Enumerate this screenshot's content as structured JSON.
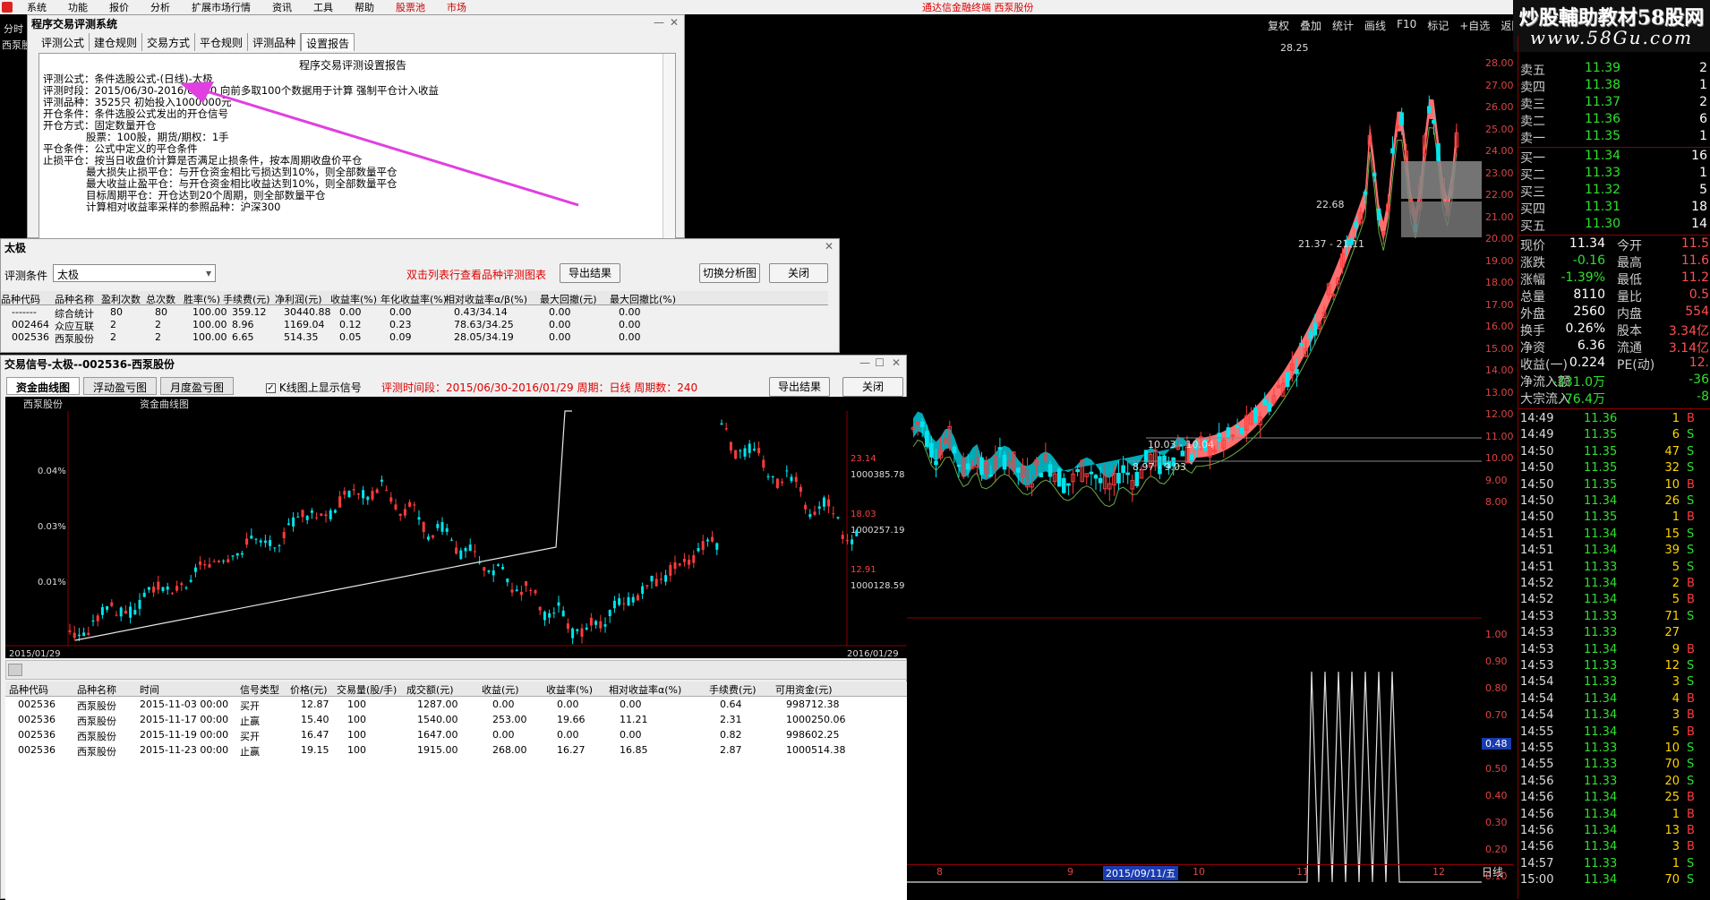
{
  "topbar": {
    "items": [
      "系统",
      "功能",
      "报价",
      "分析",
      "扩展市场行情",
      "资讯",
      "工具",
      "帮助"
    ],
    "red_items": [
      "股票池",
      "市场"
    ],
    "center_title": "通达信金融终端 西泵股份"
  },
  "left_strip": {
    "tab": "分时",
    "stock": "西泵股"
  },
  "toolbar": [
    "复权",
    "叠加",
    "统计",
    "画线",
    "F10",
    "标记",
    "+自选",
    "返回"
  ],
  "watermark": {
    "line1": "炒股輔助教材58股网",
    "line2": "www.58Gu.com"
  },
  "eval_window": {
    "title": "程序交易评测系统",
    "tabs": [
      "评测公式",
      "建仓规则",
      "交易方式",
      "平仓规则",
      "评测品种",
      "设置报告"
    ],
    "active_tab": 5,
    "report_heading": "程序交易评测设置报告",
    "report_lines": [
      {
        "indent": 0,
        "text": "评测公式：条件选股公式-(日线)-太极"
      },
      {
        "indent": 0,
        "text": "评测时段：2015/06/30-2016/01/30 向前多取100个数据用于计算 强制平仓计入收益"
      },
      {
        "indent": 0,
        "text": "评测品种：3525只 初始投入1000000元"
      },
      {
        "indent": 0,
        "text": "开仓条件：条件选股公式发出的开仓信号"
      },
      {
        "indent": 0,
        "text": "开仓方式：固定数量开仓"
      },
      {
        "indent": 1,
        "text": "股票：100股，期货/期权：1手"
      },
      {
        "indent": 0,
        "text": "平仓条件：公式中定义的平仓条件"
      },
      {
        "indent": 0,
        "text": "止损平仓：按当日收盘价计算是否满足止损条件，按本周期收盘价平仓"
      },
      {
        "indent": 1,
        "text": "最大损失止损平仓：与开仓资金相比亏损达到10%，则全部数量平仓"
      },
      {
        "indent": 1,
        "text": "最大收益止盈平仓：与开仓资金相比收益达到10%，则全部数量平仓"
      },
      {
        "indent": 1,
        "text": "目标周期平仓：开仓达到20个周期，则全部数量平仓"
      },
      {
        "indent": 1,
        "text": "计算相对收益率采样的参照品种：沪深300"
      }
    ]
  },
  "result_window": {
    "title": "太极",
    "condition_label": "评测条件",
    "condition_value": "太极",
    "hint": "双击列表行查看品种评测图表",
    "export_label": "导出结果",
    "switch_label": "切换分析图",
    "close_label": "关闭",
    "columns": [
      "品种代码",
      "品种名称",
      "盈利次数",
      "总次数",
      "胜率(%)",
      "手续费(元)",
      "净利润(元)",
      "收益率(%)",
      "年化收益率(%)",
      "相对收益率α/β(%)",
      "最大回撤(元)",
      "最大回撤比(%)"
    ],
    "rows": [
      [
        "-------",
        "综合统计",
        "80",
        "80",
        "100.00",
        "359.12",
        "30440.88",
        "0.00",
        "0.00",
        "0.43/34.14",
        "0.00",
        "0.00"
      ],
      [
        "002464",
        "众应互联",
        "2",
        "2",
        "100.00",
        "8.96",
        "1169.04",
        "0.12",
        "0.23",
        "78.63/34.25",
        "0.00",
        "0.00"
      ],
      [
        "002536",
        "西泵股份",
        "2",
        "2",
        "100.00",
        "6.65",
        "514.35",
        "0.05",
        "0.09",
        "28.05/34.19",
        "0.00",
        "0.00"
      ]
    ]
  },
  "signal_window": {
    "title": "交易信号-太极--002536-西泵股份",
    "tabs": [
      "资金曲线图",
      "浮动盈亏图",
      "月度盈亏图"
    ],
    "active_tab": 0,
    "checkbox_label": "K线图上显示信号",
    "info": "评测时间段：2015/06/30-2016/01/29  周期：日线  周期数：240",
    "export_label": "导出结果",
    "close_label": "关闭",
    "chart": {
      "stock_label": "西泵股份",
      "curve_label": "资金曲线图",
      "left_ticks": [
        "0.04%",
        "0.03%",
        "0.01%"
      ],
      "right_price_ticks": [
        "23.14",
        "18.03",
        "12.91"
      ],
      "right_fund_ticks": [
        "1000385.78",
        "1000257.19",
        "1000128.59"
      ],
      "start_date": "2015/01/29",
      "end_date": "2016/01/29"
    },
    "columns": [
      "品种代码",
      "品种名称",
      "时间",
      "信号类型",
      "价格(元)",
      "交易量(股/手)",
      "成交额(元)",
      "收益(元)",
      "收益率(%)",
      "相对收益率α(%)",
      "手续费(元)",
      "可用资金(元)"
    ],
    "rows": [
      [
        "002536",
        "西泵股份",
        "2015-11-03 00:00",
        "买开",
        "12.87",
        "100",
        "1287.00",
        "0.00",
        "0.00",
        "0.00",
        "0.64",
        "998712.38"
      ],
      [
        "002536",
        "西泵股份",
        "2015-11-17 00:00",
        "止赢",
        "15.40",
        "100",
        "1540.00",
        "253.00",
        "19.66",
        "11.21",
        "2.31",
        "1000250.06"
      ],
      [
        "002536",
        "西泵股份",
        "2015-11-19 00:00",
        "买开",
        "16.47",
        "100",
        "1647.00",
        "0.00",
        "0.00",
        "0.00",
        "0.82",
        "998602.25"
      ],
      [
        "002536",
        "西泵股份",
        "2015-11-23 00:00",
        "止赢",
        "19.15",
        "100",
        "1915.00",
        "268.00",
        "16.27",
        "16.85",
        "2.87",
        "1000514.38"
      ]
    ]
  },
  "main_chart": {
    "price_ticks": [
      "28.00",
      "27.00",
      "26.00",
      "25.00",
      "24.00",
      "23.00",
      "22.00",
      "21.00",
      "20.00",
      "19.00",
      "18.00",
      "17.00",
      "16.00",
      "15.00",
      "14.00",
      "13.00",
      "12.00",
      "11.00",
      "10.00",
      "9.00",
      "8.00"
    ],
    "indicator_ticks": [
      "1.00",
      "0.90",
      "0.80",
      "0.70",
      "0.60",
      "0.50",
      "0.40",
      "0.30",
      "0.20",
      "0.10"
    ],
    "indicator_value": "0.48",
    "annotations": [
      "28.25",
      "22.68",
      "21.37 - 21.11",
      "10.03 - 10.04",
      "8.97 - 9.03"
    ],
    "x_labels": [
      "8",
      "9",
      "2015/09/11/五",
      "10",
      "11",
      "12"
    ],
    "period": "日线"
  },
  "quote": {
    "sell": [
      [
        "卖五",
        "11.39",
        "2"
      ],
      [
        "卖四",
        "11.38",
        "1"
      ],
      [
        "卖三",
        "11.37",
        "2"
      ],
      [
        "卖二",
        "11.36",
        "6"
      ],
      [
        "卖一",
        "11.35",
        "1"
      ]
    ],
    "buy": [
      [
        "买一",
        "11.34",
        "16"
      ],
      [
        "买二",
        "11.33",
        "1"
      ],
      [
        "买三",
        "11.32",
        "5"
      ],
      [
        "买四",
        "11.31",
        "18"
      ],
      [
        "买五",
        "11.30",
        "14"
      ]
    ],
    "stats": [
      [
        "现价",
        "11.34",
        "今开",
        "11.5"
      ],
      [
        "涨跌",
        "-0.16",
        "最高",
        "11.6"
      ],
      [
        "涨幅",
        "-1.39%",
        "最低",
        "11.2"
      ],
      [
        "总量",
        "8110",
        "量比",
        "0.5"
      ],
      [
        "外盘",
        "2560",
        "内盘",
        "554"
      ],
      [
        "换手",
        "0.26%",
        "股本",
        "3.34亿"
      ],
      [
        "净资",
        "6.36",
        "流通",
        "3.14亿"
      ],
      [
        "收益(一)",
        "0.224",
        "PE(动)",
        "12."
      ],
      [
        "净流入额",
        "-331.0万",
        "",
        "-36"
      ],
      [
        "大宗流入",
        "-76.4万",
        "",
        "-8"
      ]
    ],
    "ticks": [
      [
        "14:49",
        "11.36",
        "1",
        "B"
      ],
      [
        "14:49",
        "11.35",
        "6",
        "S"
      ],
      [
        "14:50",
        "11.35",
        "47",
        "S"
      ],
      [
        "14:50",
        "11.35",
        "32",
        "S"
      ],
      [
        "14:50",
        "11.35",
        "10",
        "B"
      ],
      [
        "14:50",
        "11.34",
        "26",
        "S"
      ],
      [
        "14:50",
        "11.35",
        "1",
        "B"
      ],
      [
        "14:51",
        "11.34",
        "15",
        "S"
      ],
      [
        "14:51",
        "11.34",
        "39",
        "S"
      ],
      [
        "14:51",
        "11.33",
        "5",
        "S"
      ],
      [
        "14:52",
        "11.34",
        "2",
        "B"
      ],
      [
        "14:52",
        "11.34",
        "5",
        "B"
      ],
      [
        "14:53",
        "11.33",
        "71",
        "S"
      ],
      [
        "14:53",
        "11.33",
        "27",
        ""
      ],
      [
        "14:53",
        "11.34",
        "9",
        "B"
      ],
      [
        "14:53",
        "11.33",
        "12",
        "S"
      ],
      [
        "14:54",
        "11.33",
        "3",
        "S"
      ],
      [
        "14:54",
        "11.34",
        "4",
        "B"
      ],
      [
        "14:54",
        "11.34",
        "3",
        "B"
      ],
      [
        "14:55",
        "11.34",
        "5",
        "B"
      ],
      [
        "14:55",
        "11.33",
        "10",
        "S"
      ],
      [
        "14:55",
        "11.33",
        "70",
        "S"
      ],
      [
        "14:56",
        "11.33",
        "20",
        "S"
      ],
      [
        "14:56",
        "11.34",
        "25",
        "B"
      ],
      [
        "14:56",
        "11.34",
        "1",
        "B"
      ],
      [
        "14:56",
        "11.34",
        "13",
        "B"
      ],
      [
        "14:56",
        "11.34",
        "3",
        "B"
      ],
      [
        "14:57",
        "11.33",
        "1",
        "S"
      ],
      [
        "15:00",
        "11.34",
        "70",
        "S"
      ]
    ]
  }
}
